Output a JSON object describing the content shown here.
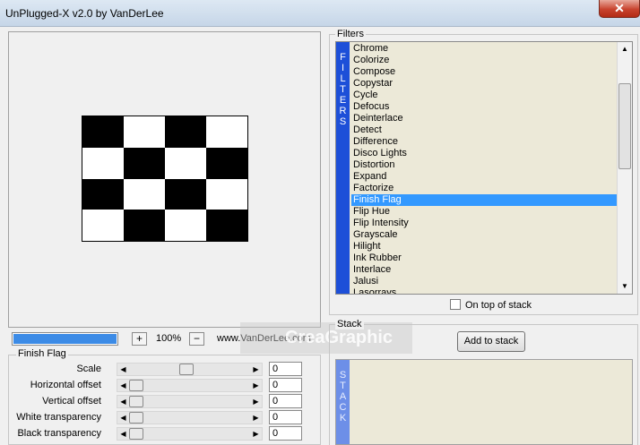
{
  "window": {
    "title": "UnPlugged-X v2.0 by VanDerLee",
    "close_label": "✕"
  },
  "preview": {
    "pattern": [
      "b",
      "w",
      "b",
      "w",
      "w",
      "b",
      "w",
      "b",
      "b",
      "w",
      "b",
      "w",
      "w",
      "b",
      "w",
      "b"
    ]
  },
  "toolbar": {
    "progress_percent": 100,
    "zoom_in_label": "+",
    "zoom_value": "100%",
    "zoom_out_label": "−",
    "site_link": "www.VanDerLee.com",
    "watermark": "CreaGraphic"
  },
  "params": {
    "group_label": "Finish Flag",
    "rows": [
      {
        "label": "Scale",
        "value": "0",
        "thumb_fraction": 0.46
      },
      {
        "label": "Horizontal offset",
        "value": "0",
        "thumb_fraction": 0.0
      },
      {
        "label": "Vertical offset",
        "value": "0",
        "thumb_fraction": 0.0
      },
      {
        "label": "White transparency",
        "value": "0",
        "thumb_fraction": 0.0
      },
      {
        "label": "Black transparency",
        "value": "0",
        "thumb_fraction": 0.0
      }
    ]
  },
  "filters": {
    "group_label": "Filters",
    "strip_text": "FILTERS",
    "items": [
      "Chrome",
      "Colorize",
      "Compose",
      "Copystar",
      "Cycle",
      "Defocus",
      "Deinterlace",
      "Detect",
      "Difference",
      "Disco Lights",
      "Distortion",
      "Expand",
      "Factorize",
      "Finish Flag",
      "Flip Hue",
      "Flip Intensity",
      "Grayscale",
      "Hilight",
      "Ink Rubber",
      "Interlace",
      "Jalusi",
      "Lasorrays"
    ],
    "selected": "Finish Flag",
    "on_top_label": "On top of stack",
    "on_top_checked": false
  },
  "stack": {
    "group_label": "Stack",
    "add_button": "Add to stack",
    "strip_text": "STACK"
  }
}
